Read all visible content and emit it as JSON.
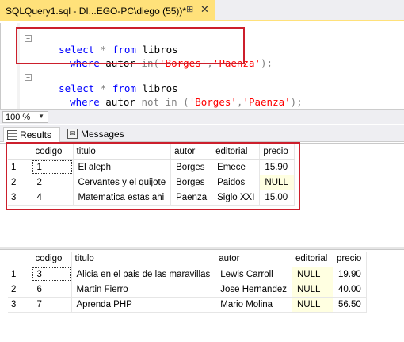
{
  "tab": {
    "title": "SQLQuery1.sql - DI...EGO-PC\\diego (55))*",
    "pin": "⊞",
    "close": "✕"
  },
  "editor": {
    "query1_line1_kw1": "select",
    "query1_line1_star": "*",
    "query1_line1_kw2": "from",
    "query1_line1_table": "libros",
    "query1_line2_kw": "where",
    "query1_line2_col": "autor",
    "query1_line2_in": "in",
    "query1_line2_open": "(",
    "query1_line2_v1": "'Borges'",
    "query1_line2_comma": ",",
    "query1_line2_v2": "'Paenza'",
    "query1_line2_close": ");",
    "query2_line1_kw1": "select",
    "query2_line1_star": "*",
    "query2_line1_kw2": "from",
    "query2_line1_table": "libros",
    "query2_line2_kw": "where",
    "query2_line2_col": "autor",
    "query2_line2_not": "not",
    "query2_line2_in": "in",
    "query2_line2_open": "(",
    "query2_line2_v1": "'Borges'",
    "query2_line2_comma": ",",
    "query2_line2_v2": "'Paenza'",
    "query2_line2_close": ");"
  },
  "zoom": {
    "value": "100 %"
  },
  "results_tabs": {
    "results": "Results",
    "messages": "Messages"
  },
  "grid1": {
    "columns": [
      "codigo",
      "titulo",
      "autor",
      "editorial",
      "precio"
    ],
    "rows": [
      {
        "n": "1",
        "codigo": "1",
        "titulo": "El aleph",
        "autor": "Borges",
        "editorial": "Emece",
        "precio": "15.90"
      },
      {
        "n": "2",
        "codigo": "2",
        "titulo": "Cervantes y el quijote",
        "autor": "Borges",
        "editorial": "Paidos",
        "precio": "NULL"
      },
      {
        "n": "3",
        "codigo": "4",
        "titulo": "Matematica estas ahi",
        "autor": "Paenza",
        "editorial": "Siglo XXI",
        "precio": "15.00"
      }
    ]
  },
  "grid2": {
    "columns": [
      "codigo",
      "titulo",
      "autor",
      "editorial",
      "precio"
    ],
    "rows": [
      {
        "n": "1",
        "codigo": "3",
        "titulo": "Alicia en el pais de las maravillas",
        "autor": "Lewis Carroll",
        "editorial": "NULL",
        "precio": "19.90"
      },
      {
        "n": "2",
        "codigo": "6",
        "titulo": "Martin Fierro",
        "autor": "Jose Hernandez",
        "editorial": "NULL",
        "precio": "40.00"
      },
      {
        "n": "3",
        "codigo": "7",
        "titulo": "Aprenda PHP",
        "autor": "Mario Molina",
        "editorial": "NULL",
        "precio": "56.50"
      }
    ]
  },
  "colors": {
    "tab_active": "#ffe17a",
    "keyword": "#0000ff",
    "string": "#ff0000",
    "highlight_box": "#cc1f2c",
    "null_cell": "#ffffe1"
  }
}
